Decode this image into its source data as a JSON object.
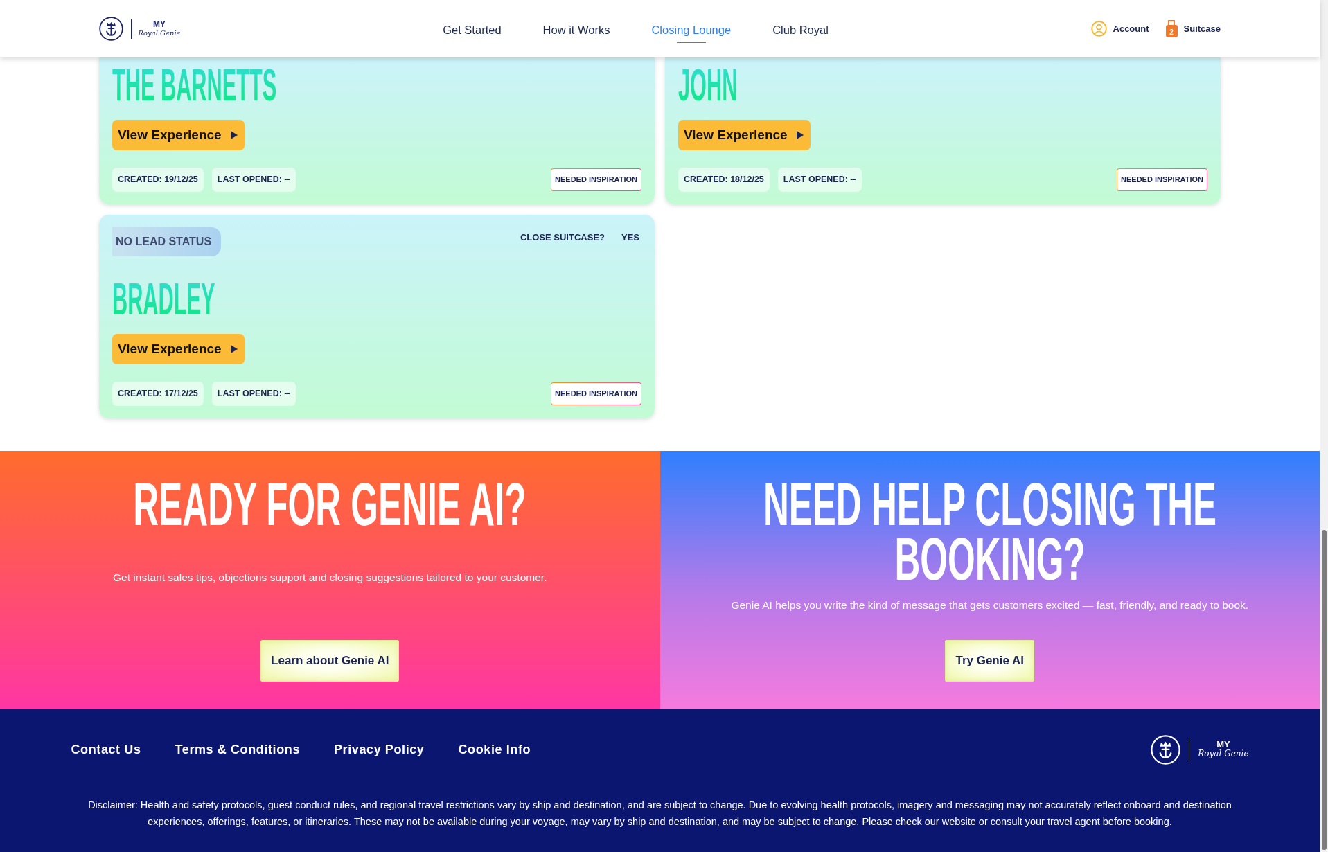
{
  "header": {
    "logo": {
      "wordmark": "MY",
      "script": "Royal Genie"
    },
    "nav": [
      {
        "label": "Get Started",
        "selected": false
      },
      {
        "label": "How it Works",
        "selected": false
      },
      {
        "label": "Closing Lounge",
        "selected": true
      },
      {
        "label": "Club Royal",
        "selected": false
      }
    ],
    "account": {
      "label": "Account"
    },
    "suitcase": {
      "label": "Suitcase",
      "count": "2"
    }
  },
  "cards": [
    {
      "name": "THE BARNETTS",
      "button": "View Experience",
      "created": "CREATED: 19/12/25",
      "last_opened": "LAST OPENED: --",
      "badge": "NEEDED INSPIRATION"
    },
    {
      "name": "JOHN",
      "button": "View Experience",
      "created": "CREATED: 18/12/25",
      "last_opened": "LAST OPENED: --",
      "badge": "NEEDED INSPIRATION"
    },
    {
      "lead_status": "NO LEAD STATUS",
      "close_suitcase": {
        "label": "CLOSE SUITCASE?",
        "value": "YES"
      },
      "name": "BRADLEY",
      "button": "View Experience",
      "created": "CREATED: 17/12/25",
      "last_opened": "LAST OPENED: --",
      "badge": "NEEDED INSPIRATION"
    }
  ],
  "promos": [
    {
      "title": "READY FOR GENIE AI?",
      "text": "Get instant sales tips, objections support and closing suggestions tailored to your customer.",
      "button": "Learn about Genie AI"
    },
    {
      "title": "NEED HELP CLOSING THE BOOKING?",
      "text": "Genie AI helps you write the kind of message that gets customers excited — fast, friendly, and ready to book.",
      "button": "Try Genie AI"
    }
  ],
  "footer": {
    "links": [
      "Contact Us",
      "Terms & Conditions",
      "Privacy Policy",
      "Cookie Info"
    ],
    "logo": {
      "wordmark": "MY",
      "script": "Royal Genie"
    },
    "disclaimer": "Disclaimer: Health and safety protocols, guest conduct rules, and regional travel restrictions vary by ship and destination, and are subject to change. Due to evolving health protocols, imagery and messaging may not accurately reflect onboard and destination experiences, offerings, features, or itineraries. These may not be available during your voyage, may vary by ship and destination, and may be subject to change. Please check our website or consult your travel agent before booking."
  }
}
